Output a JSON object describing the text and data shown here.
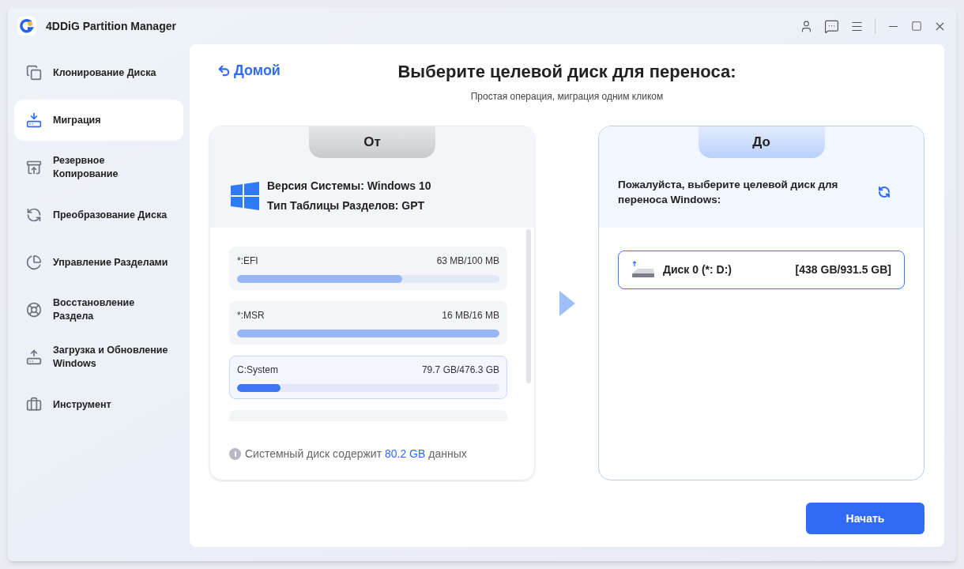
{
  "app": {
    "title": "4DDiG Partition Manager"
  },
  "sidebar": {
    "items": [
      {
        "label": "Клонирование Диска",
        "kind": "clone",
        "selected": false
      },
      {
        "label": "Миграция",
        "kind": "migrate",
        "selected": true
      },
      {
        "label": "Резервное Копирование",
        "kind": "backup",
        "selected": false
      },
      {
        "label": "Преобразование Диска",
        "kind": "convert",
        "selected": false
      },
      {
        "label": "Управление Разделами",
        "kind": "partition",
        "selected": false
      },
      {
        "label": "Восстановление Раздела",
        "kind": "recover",
        "selected": false
      },
      {
        "label": "Загрузка и Обновление Windows",
        "kind": "boot",
        "selected": false
      },
      {
        "label": "Инструмент",
        "kind": "tools",
        "selected": false
      }
    ]
  },
  "header": {
    "back": "Домой",
    "title": "Выберите целевой диск для переноса:",
    "subtitle": "Простая операция, миграция одним кликом"
  },
  "source": {
    "tab": "От",
    "system_version": "Версия Системы: Windows 10",
    "table_type": "Тип Таблицы Разделов: GPT",
    "partitions": [
      {
        "name": "*:EFI",
        "size": "63 MB/100 MB",
        "level": 0.63,
        "selected": false
      },
      {
        "name": "*:MSR",
        "size": "16 MB/16 MB",
        "level": 1.0,
        "selected": false
      },
      {
        "name": "C:System",
        "size": "79.7 GB/476.3 GB",
        "level": 0.167,
        "selected": true
      }
    ],
    "note": "Системный диск содержит ",
    "note_amount": "80.2 GB",
    "note_end": " данных"
  },
  "target": {
    "tab": "До",
    "prompt": "Пожалуйста, выберите целевой диск для переноса Windows:",
    "disks": [
      {
        "name": "Диск 0 (*: D:)",
        "size": "[438 GB/931.5 GB]",
        "selected": true
      }
    ]
  },
  "start_button": "Начать"
}
